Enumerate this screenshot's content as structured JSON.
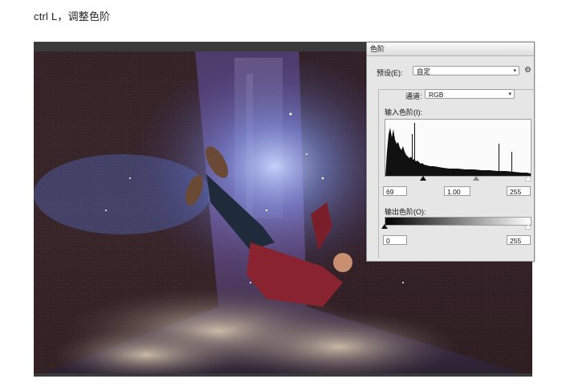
{
  "caption": "ctrl  L，调整色阶",
  "dialog": {
    "title": "色阶",
    "preset_label": "预设(E):",
    "preset_value": "自定",
    "channel_label": "通道:",
    "channel_value": "RGB",
    "input_levels_label": "输入色阶(I):",
    "input_black": "69",
    "input_gamma": "1.00",
    "input_white": "255",
    "output_levels_label": "输出色阶(O):",
    "output_black": "0",
    "output_white": "255"
  },
  "icons": {
    "dropdown": "▾",
    "gear": "⚙"
  }
}
